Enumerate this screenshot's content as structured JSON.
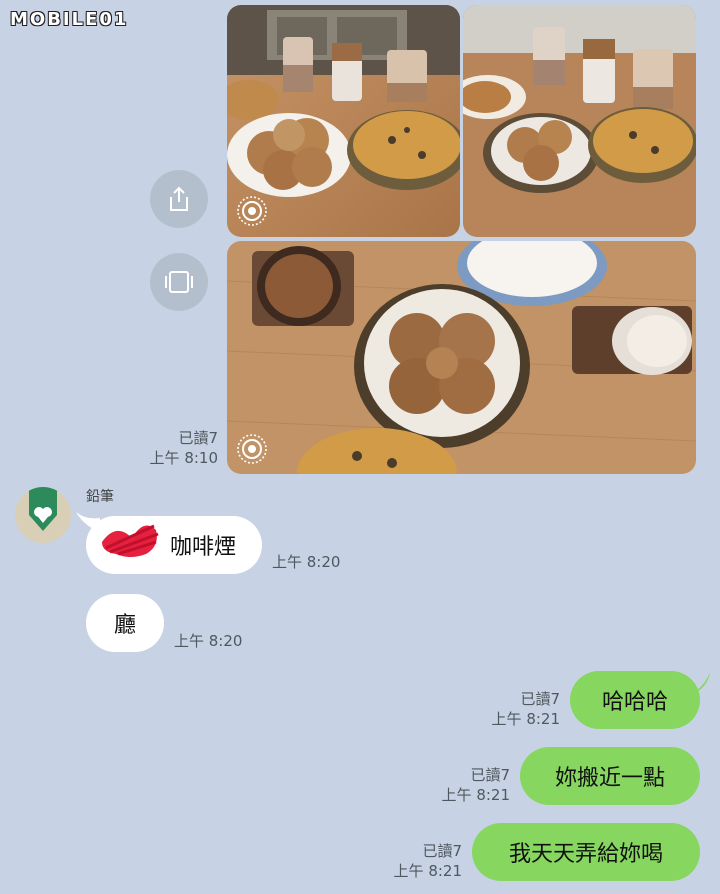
{
  "watermark": {
    "text": "MOBILE01"
  },
  "photos": {
    "live_label": "live-photo-icon"
  },
  "actions": {
    "share_icon": "share-icon",
    "gallery_icon": "gallery-icon"
  },
  "messages": {
    "photo_meta": {
      "read": "已讀7",
      "time": "上午 8:10"
    },
    "sender": {
      "name": "鉛筆"
    },
    "in1": {
      "text": "咖啡煙",
      "time": "上午 8:20"
    },
    "in2": {
      "text": "廳",
      "time": "上午 8:20"
    },
    "out1": {
      "text": "哈哈哈",
      "read": "已讀7",
      "time": "上午 8:21"
    },
    "out2": {
      "text": "妳搬近一點",
      "read": "已讀7",
      "time": "上午 8:21"
    },
    "out3": {
      "text": "我天天弄給妳喝",
      "read": "已讀7",
      "time": "上午 8:21"
    }
  },
  "colors": {
    "background": "#c7d3e4",
    "outgoing_bubble": "#86d65f",
    "incoming_bubble": "#ffffff"
  }
}
